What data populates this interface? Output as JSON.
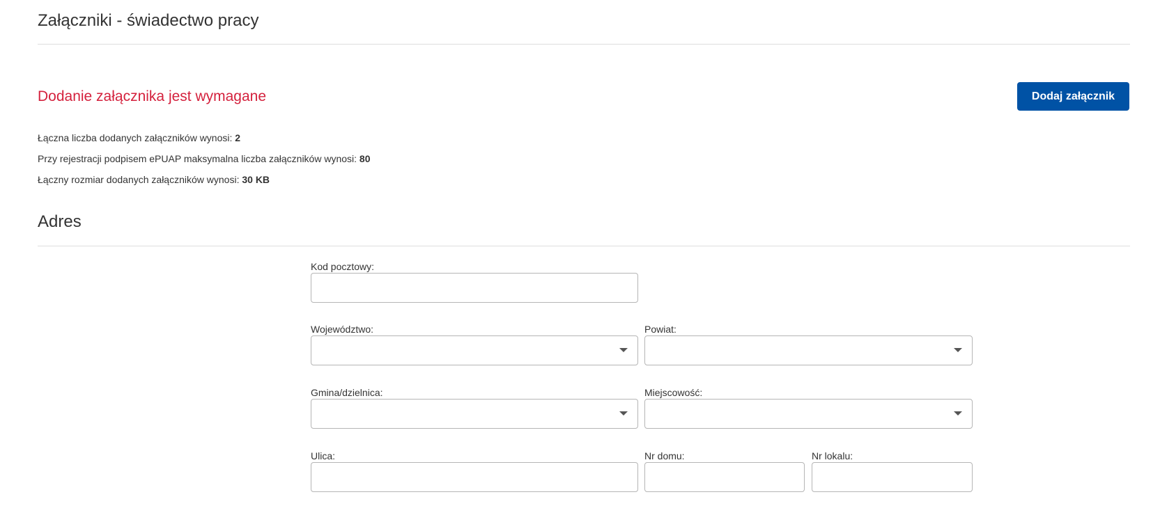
{
  "attachments": {
    "title": "Załączniki - świadectwo pracy",
    "required_message": "Dodanie załącznika jest wymagane",
    "add_button_label": "Dodaj załącznik",
    "info": [
      {
        "text": "Łączna liczba dodanych załączników wynosi: ",
        "value": "2"
      },
      {
        "text": "Przy rejestracji podpisem ePUAP maksymalna liczba załączników wynosi: ",
        "value": "80"
      },
      {
        "text": "Łączny rozmiar dodanych załączników wynosi: ",
        "value": "30 KB"
      }
    ]
  },
  "address": {
    "title": "Adres",
    "fields": {
      "postal_code": {
        "label": "Kod pocztowy:",
        "value": ""
      },
      "voivodeship": {
        "label": "Województwo:",
        "value": ""
      },
      "county": {
        "label": "Powiat:",
        "value": ""
      },
      "commune": {
        "label": "Gmina/dzielnica:",
        "value": ""
      },
      "locality": {
        "label": "Miejscowość:",
        "value": ""
      },
      "street": {
        "label": "Ulica:",
        "value": ""
      },
      "house_number": {
        "label": "Nr domu:",
        "value": ""
      },
      "apartment_number": {
        "label": "Nr lokalu:",
        "value": ""
      }
    }
  },
  "colors": {
    "accent": "#0052a5",
    "error": "#d4213d",
    "divider": "#dedede",
    "field_border": "#b5b5b5"
  },
  "icons": {
    "dropdown": "caret-down-icon"
  }
}
